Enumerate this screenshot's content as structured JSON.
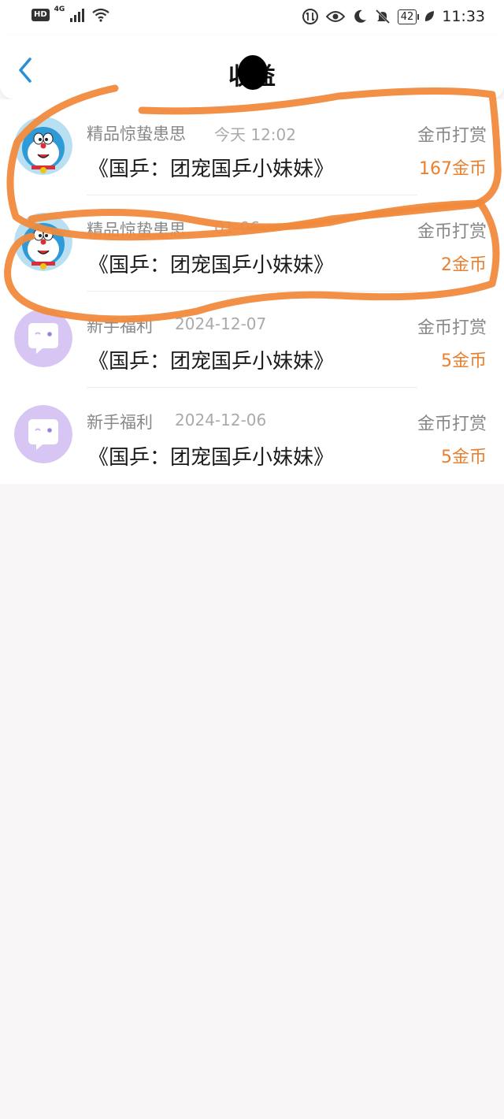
{
  "status_bar": {
    "hd": "HD",
    "network": "4G",
    "battery": "42",
    "time": "11:33"
  },
  "header": {
    "title": "收益",
    "back_icon": "chevron-left-icon"
  },
  "colors": {
    "accent_blue": "#2b8fd6",
    "amount_orange": "#e9802f",
    "annotation_orange": "#f08a3c",
    "system_avatar_purple": "#d7c6f3"
  },
  "records": [
    {
      "avatar": "doraemon-avatar",
      "source": "精品惊蛰患思",
      "date": "今天 12:02",
      "kind": "金币打赏",
      "book": "《国乒：团宠国乒小妹妹》",
      "amount": "167金币"
    },
    {
      "avatar": "doraemon-avatar",
      "source": "精品惊蛰患思",
      "date": "01-06",
      "kind": "金币打赏",
      "book": "《国乒：团宠国乒小妹妹》",
      "amount": "2金币"
    },
    {
      "avatar": "chat-bubble-avatar",
      "source": "新手福利",
      "date": "2024-12-07",
      "kind": "金币打赏",
      "book": "《国乒：团宠国乒小妹妹》",
      "amount": "5金币"
    },
    {
      "avatar": "chat-bubble-avatar",
      "source": "新手福利",
      "date": "2024-12-06",
      "kind": "金币打赏",
      "book": "《国乒：团宠国乒小妹妹》",
      "amount": "5金币"
    }
  ]
}
